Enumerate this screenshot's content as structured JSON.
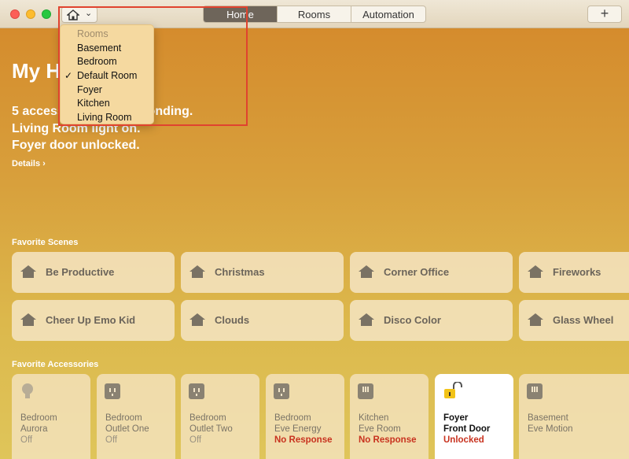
{
  "window": {
    "tabs": [
      "Home",
      "Rooms",
      "Automation"
    ],
    "selected_tab": "Home",
    "add_label": "+"
  },
  "home": {
    "title": "My Home",
    "status_lines": [
      "5 accessories not responding.",
      "Living Room light on.",
      "Foyer door unlocked."
    ],
    "details_label": "Details ›"
  },
  "room_menu": {
    "header": "Rooms",
    "items": [
      "Basement",
      "Bedroom",
      "Default Room",
      "Foyer",
      "Kitchen",
      "Living Room"
    ],
    "checked": "Default Room",
    "check_mark": "✓"
  },
  "scenes": {
    "label": "Favorite Scenes",
    "items": [
      "Be Productive",
      "Christmas",
      "Corner Office",
      "Fireworks",
      "Cheer Up Emo Kid",
      "Clouds",
      "Disco Color",
      "Glass Wheel"
    ]
  },
  "accessories": {
    "label": "Favorite Accessories",
    "items": [
      {
        "room": "Bedroom",
        "name": "Aurora",
        "status": "Off",
        "icon": "bulb-icon"
      },
      {
        "room": "Bedroom",
        "name": "Outlet One",
        "status": "Off",
        "icon": "outlet-icon"
      },
      {
        "room": "Bedroom",
        "name": "Outlet Two",
        "status": "Off",
        "icon": "outlet-icon"
      },
      {
        "room": "Bedroom",
        "name": "Eve Energy",
        "status": "No Response",
        "icon": "outlet-icon"
      },
      {
        "room": "Kitchen",
        "name": "Eve Room",
        "status": "No Response",
        "icon": "sensor-icon"
      },
      {
        "room": "Foyer",
        "name": "Front Door",
        "status": "Unlocked",
        "icon": "lock-icon"
      },
      {
        "room": "Basement",
        "name": "Eve Motion",
        "status": "",
        "icon": "sensor-icon"
      }
    ]
  },
  "colors": {
    "background_top": "#d4882a",
    "background_bottom": "#dfc55a",
    "alert": "#c8321f",
    "highlight_box": "#e0432f"
  }
}
